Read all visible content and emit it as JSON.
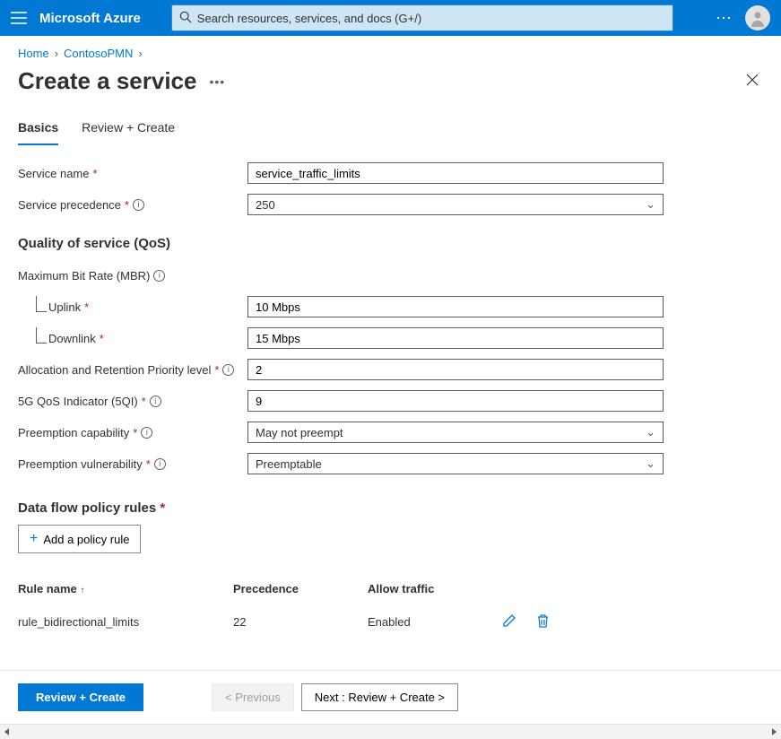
{
  "header": {
    "brand": "Microsoft Azure",
    "search_placeholder": "Search resources, services, and docs (G+/)"
  },
  "breadcrumb": {
    "items": [
      "Home",
      "ContosoPMN"
    ]
  },
  "page": {
    "title": "Create a service"
  },
  "tabs": [
    {
      "label": "Basics",
      "active": true
    },
    {
      "label": "Review + Create",
      "active": false
    }
  ],
  "form": {
    "service_name_label": "Service name",
    "service_name_value": "service_traffic_limits",
    "service_precedence_label": "Service precedence",
    "service_precedence_value": "250",
    "qos_heading": "Quality of service (QoS)",
    "mbr_label": "Maximum Bit Rate (MBR)",
    "uplink_label": "Uplink",
    "uplink_value": "10 Mbps",
    "downlink_label": "Downlink",
    "downlink_value": "15 Mbps",
    "arp_label": "Allocation and Retention Priority level",
    "arp_value": "2",
    "qos5qi_label": "5G QoS Indicator (5QI)",
    "qos5qi_value": "9",
    "preempt_cap_label": "Preemption capability",
    "preempt_cap_value": "May not preempt",
    "preempt_vuln_label": "Preemption vulnerability",
    "preempt_vuln_value": "Preemptable"
  },
  "rules": {
    "heading": "Data flow policy rules",
    "add_label": "Add a policy rule",
    "columns": {
      "name": "Rule name",
      "precedence": "Precedence",
      "allow": "Allow traffic"
    },
    "items": [
      {
        "name": "rule_bidirectional_limits",
        "precedence": "22",
        "allow": "Enabled"
      }
    ]
  },
  "footer": {
    "review_create": "Review + Create",
    "previous": "< Previous",
    "next": "Next : Review + Create >"
  }
}
